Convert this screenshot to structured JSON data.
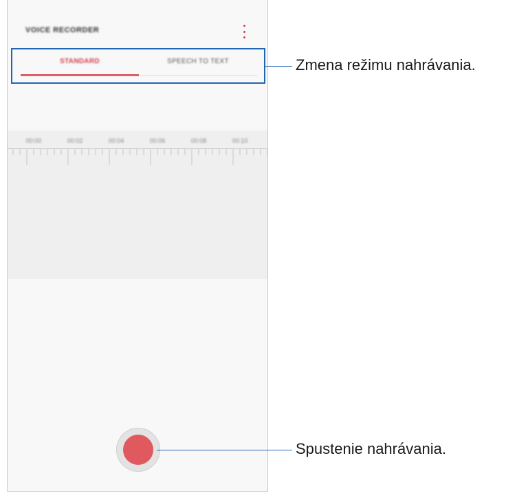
{
  "app": {
    "title": "VOICE RECORDER"
  },
  "tabs": [
    {
      "label": "STANDARD",
      "selected": true
    },
    {
      "label": "SPEECH TO TEXT",
      "selected": false
    }
  ],
  "timeline": {
    "labels": [
      "00:00",
      "00:02",
      "00:04",
      "00:06",
      "00:08",
      "00:10"
    ]
  },
  "callouts": {
    "mode": "Zmena režimu nahrávania.",
    "record": "Spustenie nahrávania."
  },
  "icons": {
    "menu": "more-vert-icon",
    "record": "record-icon"
  },
  "colors": {
    "accent": "#d2404d",
    "record": "#e0595e",
    "highlight_box": "#1f66b0"
  }
}
